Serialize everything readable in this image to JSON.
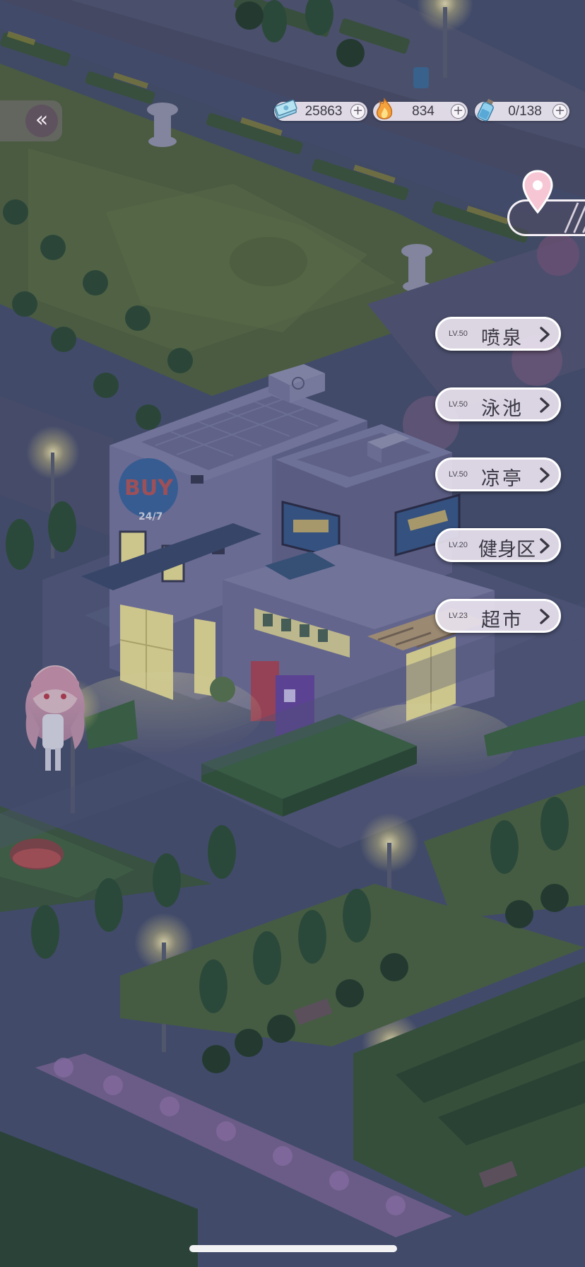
{
  "hud": {
    "back_label": "«",
    "resources": [
      {
        "name": "cash",
        "icon": "cash-stack-icon",
        "value": "25863",
        "plus": "+"
      },
      {
        "name": "energy",
        "icon": "flame-icon",
        "value": "834",
        "plus": "+"
      },
      {
        "name": "stamina",
        "icon": "potion-bottle-icon",
        "value": "0/138",
        "plus": "+"
      }
    ],
    "location_icon": "location-pin-icon"
  },
  "facilities": [
    {
      "level": "LV.50",
      "name": "喷泉"
    },
    {
      "level": "LV.50",
      "name": "泳池"
    },
    {
      "level": "LV.50",
      "name": "凉亭"
    },
    {
      "level": "LV.20",
      "name": "健身区"
    },
    {
      "level": "LV.23",
      "name": "超市"
    }
  ],
  "store_sign": {
    "brand": "BUY",
    "hours": "24/7"
  },
  "colors": {
    "night_overlay": "#3d4568",
    "window_glow": "#f3ea9a",
    "button_fill": "#e8e2ee",
    "button_border": "#ffffff"
  }
}
